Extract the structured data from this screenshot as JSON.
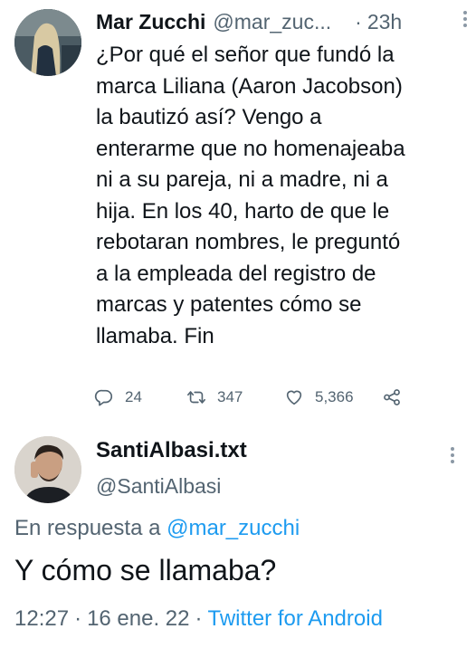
{
  "tweet": {
    "author_name": "Mar Zucchi",
    "author_handle": "@mar_zuc...",
    "separator": "·",
    "time": "23h",
    "body_lines": [
      "¿Por qué el señor que fundó la",
      "marca Liliana (Aaron Jacobson)",
      "la bautizó así? Vengo a",
      "enterarme que no homenajeaba",
      "ni a su pareja, ni a madre, ni a",
      "hija. En los 40, harto de que le",
      "rebotaran nombres, le preguntó",
      "a la empleada del registro de",
      "marcas y patentes cómo se",
      "llamaba. Fin"
    ],
    "replies": "24",
    "retweets": "347",
    "likes": "5,366"
  },
  "reply": {
    "author_name": "SantiAlbasi.txt",
    "author_handle": "@SantiAlbasi",
    "reply_prefix": "En respuesta a",
    "reply_mention": "@mar_zucchi",
    "body": "Y cómo se llamaba?",
    "time": "12:27",
    "date": "16 ene. 22",
    "separator": "·",
    "source": "Twitter for Android"
  },
  "colors": {
    "text": "#0f1419",
    "secondary": "#536471",
    "link": "#1d9bf0"
  },
  "icons": {
    "reply": "reply-icon",
    "retweet": "retweet-icon",
    "like": "heart-icon",
    "share": "share-icon",
    "more": "more-vertical-icon"
  }
}
